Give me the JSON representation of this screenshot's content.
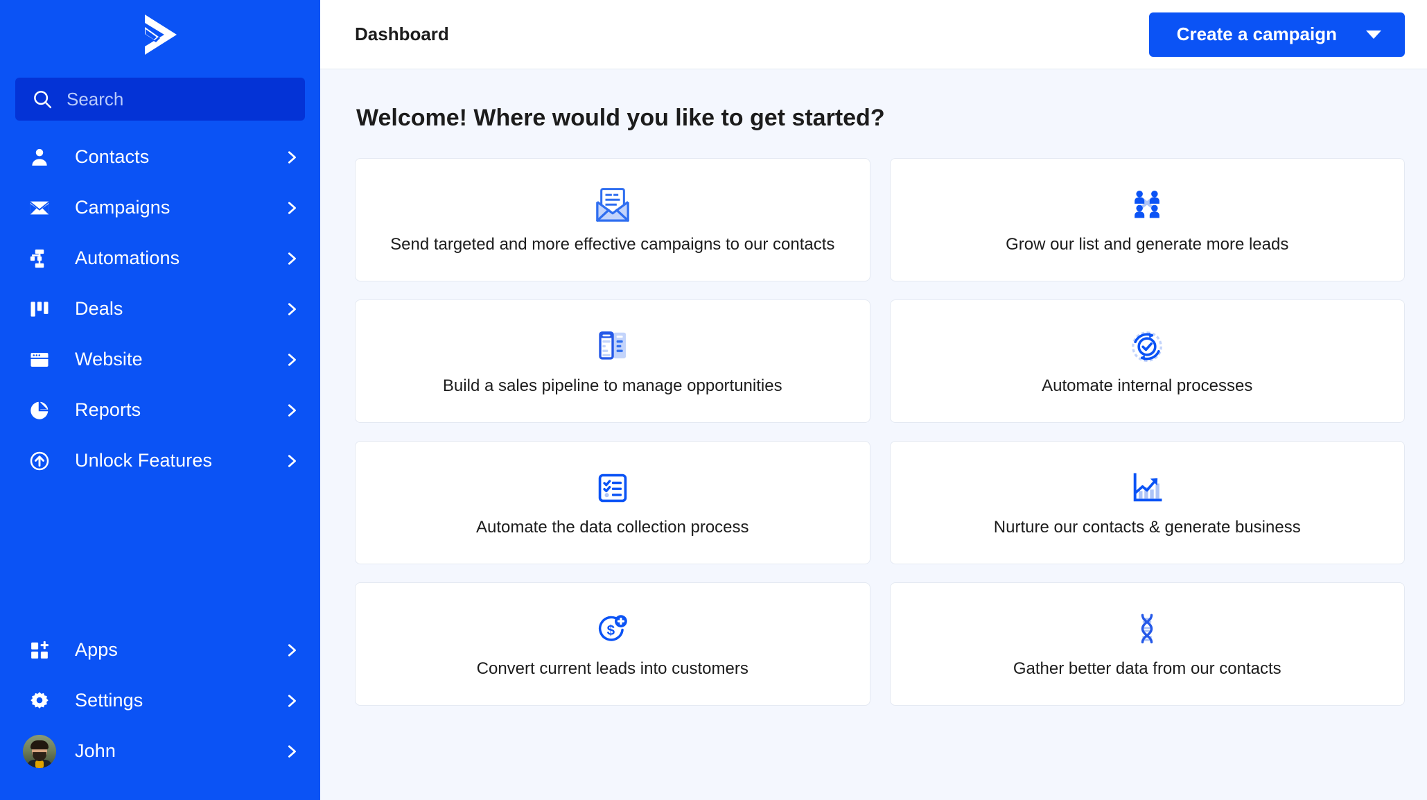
{
  "brand": {
    "logo_icon": "activecampaign-logo-icon",
    "sidebar_bg": "#0b53f5",
    "accent": "#0b53f5",
    "search_bg": "#0433d6",
    "page_bg": "#f4f7fe",
    "icon_light": "#aec4f7"
  },
  "sidebar": {
    "search": {
      "placeholder": "Search",
      "value": "",
      "icon": "search-icon"
    },
    "items": [
      {
        "label": "Contacts",
        "icon": "person-icon",
        "chevron": "chevron-right-icon"
      },
      {
        "label": "Campaigns",
        "icon": "envelope-icon",
        "chevron": "chevron-right-icon"
      },
      {
        "label": "Automations",
        "icon": "sitemap-icon",
        "chevron": "chevron-right-icon"
      },
      {
        "label": "Deals",
        "icon": "columns-icon",
        "chevron": "chevron-right-icon"
      },
      {
        "label": "Website",
        "icon": "browser-window-icon",
        "chevron": "chevron-right-icon"
      },
      {
        "label": "Reports",
        "icon": "pie-chart-icon",
        "chevron": "chevron-right-icon"
      },
      {
        "label": "Unlock Features",
        "icon": "arrow-up-circle-icon",
        "chevron": "chevron-right-icon"
      }
    ],
    "bottom_items": [
      {
        "label": "Apps",
        "icon": "apps-grid-plus-icon",
        "chevron": "chevron-right-icon"
      },
      {
        "label": "Settings",
        "icon": "gear-icon",
        "chevron": "chevron-right-icon"
      },
      {
        "label": "John",
        "icon": "avatar",
        "chevron": "chevron-right-icon"
      }
    ]
  },
  "topbar": {
    "title": "Dashboard",
    "create_button": {
      "label": "Create a campaign",
      "dropdown_icon": "caret-down-icon"
    }
  },
  "main": {
    "heading": "Welcome! Where would you like to get started?",
    "cards": [
      {
        "label": "Send targeted and more effective campaigns to our contacts",
        "icon": "envelope-open-icon"
      },
      {
        "label": "Grow our list and generate more leads",
        "icon": "people-group-icon"
      },
      {
        "label": "Build a sales pipeline to manage opportunities",
        "icon": "pipeline-columns-icon"
      },
      {
        "label": "Automate internal processes",
        "icon": "sync-check-icon"
      },
      {
        "label": "Automate the data collection process",
        "icon": "checklist-icon"
      },
      {
        "label": "Nurture our contacts & generate business",
        "icon": "growth-chart-icon"
      },
      {
        "label": "Convert current leads into customers",
        "icon": "dollar-plus-icon"
      },
      {
        "label": "Gather better data from our contacts",
        "icon": "dna-helix-icon"
      }
    ]
  }
}
